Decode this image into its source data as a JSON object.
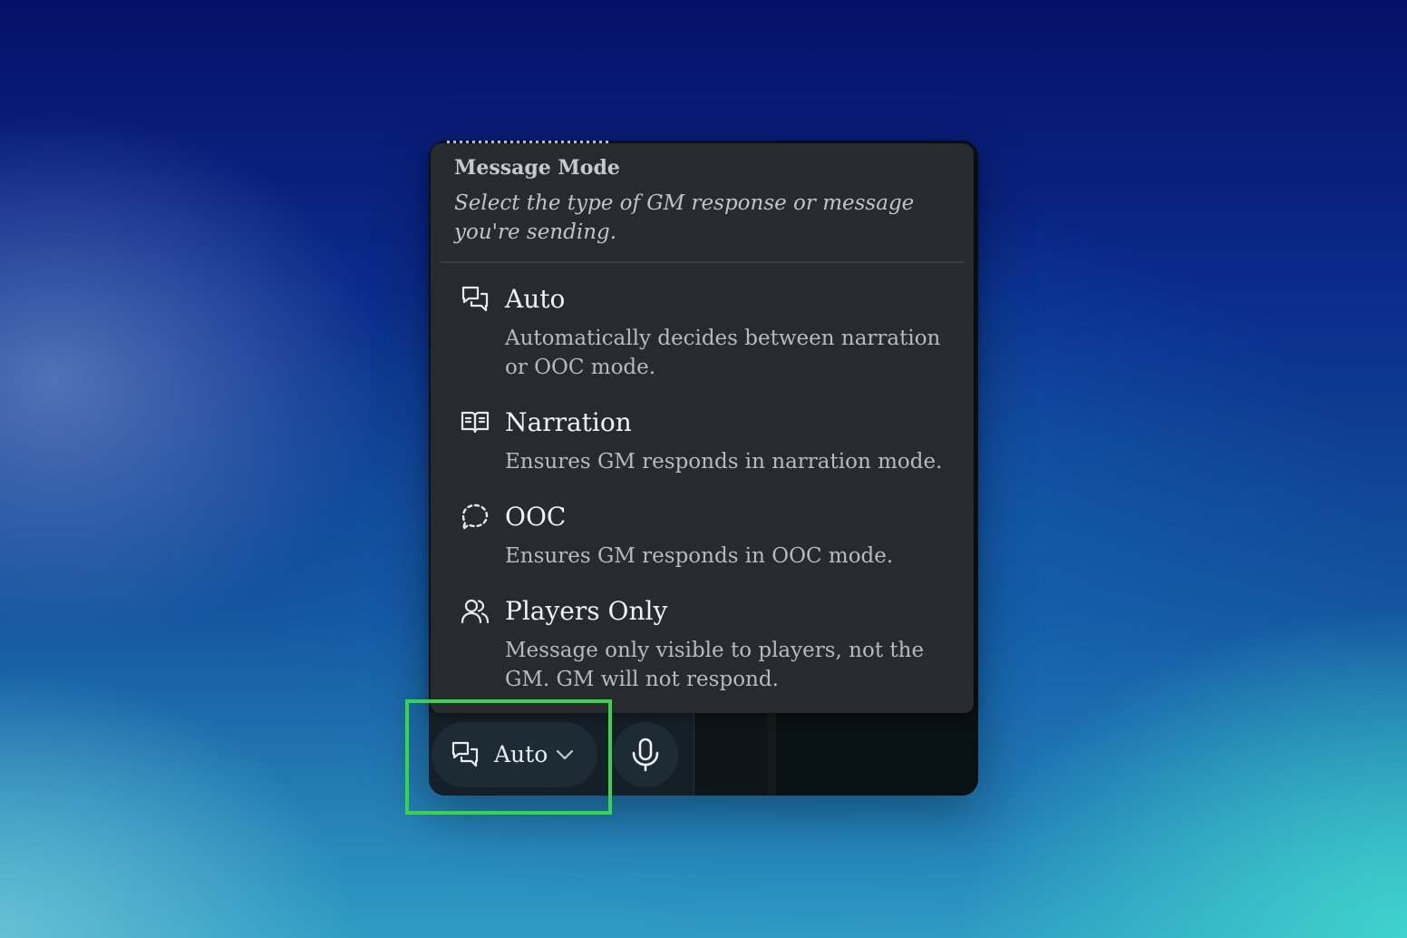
{
  "popover": {
    "title": "Message Mode",
    "subtitle": "Select the type of GM response or message you're sending.",
    "options": [
      {
        "icon": "chat-bubbles-icon",
        "label": "Auto",
        "description": "Automatically decides between narration or OOC mode."
      },
      {
        "icon": "open-book-icon",
        "label": "Narration",
        "description": "Ensures GM responds in narration mode."
      },
      {
        "icon": "dashed-chat-bubble-icon",
        "label": "OOC",
        "description": "Ensures GM responds in OOC mode."
      },
      {
        "icon": "users-icon",
        "label": "Players Only",
        "description": "Message only visible to players, not the GM. GM will not respond."
      }
    ]
  },
  "toolbar": {
    "mode_select": {
      "icon": "chat-bubbles-icon",
      "selected_value": "Auto"
    },
    "mic_icon": "microphone-icon"
  },
  "colors": {
    "popover_background": "#292a2f",
    "toolbar_button_background": "#1d2b35",
    "highlight": "#39d548"
  }
}
